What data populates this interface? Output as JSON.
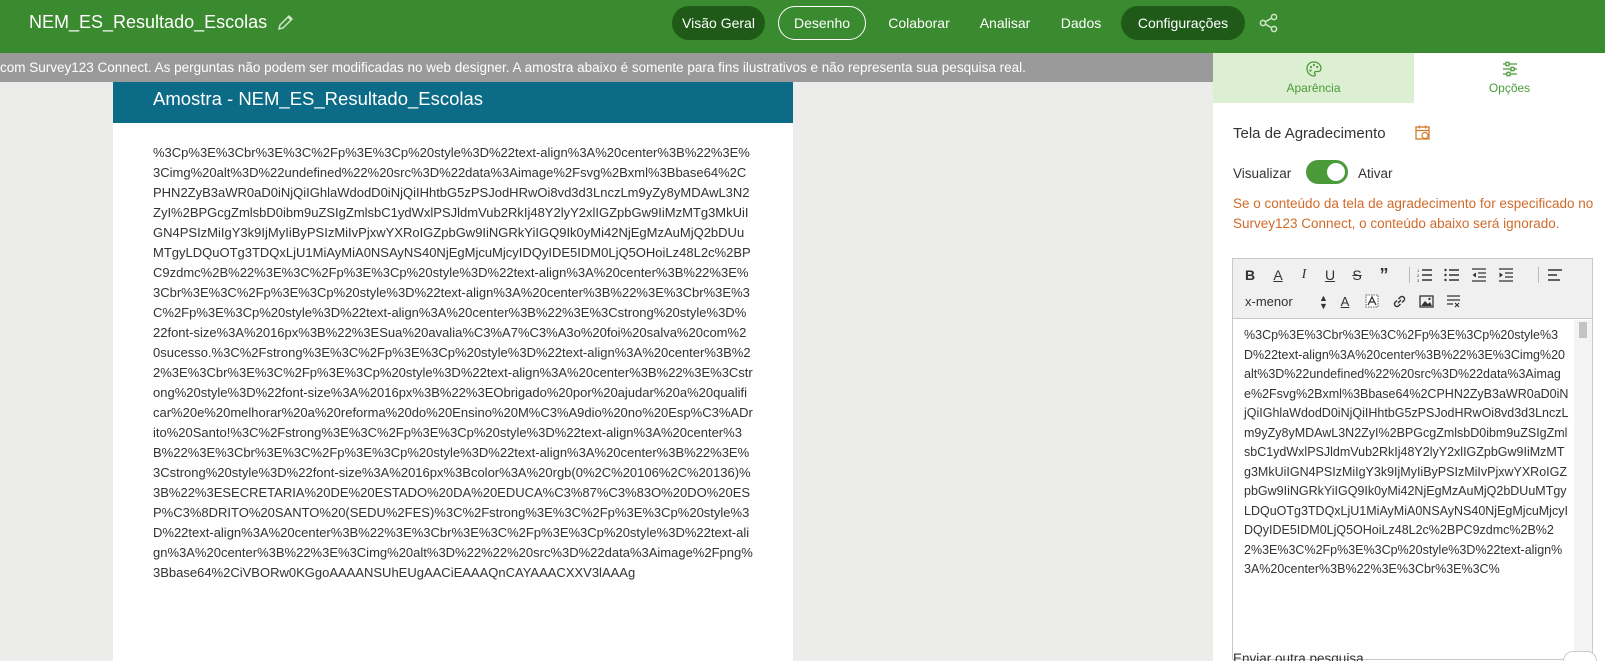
{
  "app": {
    "title": "NEM_ES_Resultado_Escolas",
    "brand_color": "#3a8a2f",
    "nav": [
      {
        "label": "Visão Geral",
        "state": "active"
      },
      {
        "label": "Desenho",
        "state": "outlined"
      },
      {
        "label": "Colaborar",
        "state": "normal"
      },
      {
        "label": "Analisar",
        "state": "normal"
      },
      {
        "label": "Dados",
        "state": "normal"
      },
      {
        "label": "Configurações",
        "state": "active"
      }
    ],
    "icons": {
      "edit": "pencil-icon",
      "share": "share-icon"
    }
  },
  "notice": {
    "text": "com Survey123 Connect. As perguntas não podem ser modificadas no web designer. A amostra abaixo é somente para fins ilustrativos e não representa sua pesquisa real."
  },
  "preview": {
    "header": "Amostra - NEM_ES_Resultado_Escolas",
    "header_color": "#0c6b86",
    "body": "%3Cp%3E%3Cbr%3E%3C%2Fp%3E%3Cp%20style%3D%22text-align%3A%20center%3B%22%3E%3Cimg%20alt%3D%22undefined%22%20src%3D%22data%3Aimage%2Fsvg%2Bxml%3Bbase64%2CPHN2ZyB3aWR0aD0iNjQiIGhlaWdodD0iNjQiIHhtbG5zPSJodHRwOi8vd3d3LnczLm9yZy8yMDAwL3N2ZyI%2BPGcgZmlsbD0ibm9uZSIgZmlsbC1ydWxlPSJldmVub2RkIj48Y2lyY2xlIGZpbGw9IiMzMTg3MkUiIGN4PSIzMiIgY3k9IjMyIiByPSIzMiIvPjxwYXRoIGZpbGw9IiNGRkYiIGQ9Ik0yMi42NjEgMzAuMjQ2bDUuMTgyLDQuOTg3TDQxLjU1MiAyMiA0NSAyNS40NjEgMjcuMjcyIDQyIDE5IDM0LjQ5OHoiLz48L2c%2BPC9zdmc%2B%22%3E%3C%2Fp%3E%3Cp%20style%3D%22text-align%3A%20center%3B%22%3E%3Cbr%3E%3C%2Fp%3E%3Cp%20style%3D%22text-align%3A%20center%3B%22%3E%3Cbr%3E%3C%2Fp%3E%3Cp%20style%3D%22text-align%3A%20center%3B%22%3E%3Cstrong%20style%3D%22font-size%3A%2016px%3B%22%3ESua%20avalia%C3%A7%C3%A3o%20foi%20salva%20com%20sucesso.%3C%2Fstrong%3E%3C%2Fp%3E%3Cp%20style%3D%22text-align%3A%20center%3B%22%3E%3Cbr%3E%3C%2Fp%3E%3Cp%20style%3D%22text-align%3A%20center%3B%22%3E%3Cstrong%20style%3D%22font-size%3A%2016px%3B%22%3EObrigado%20por%20ajudar%20a%20qualificar%20e%20melhorar%20a%20reforma%20do%20Ensino%20M%C3%A9dio%20no%20Esp%C3%ADrito%20Santo!%3C%2Fstrong%3E%3C%2Fp%3E%3Cp%20style%3D%22text-align%3A%20center%3B%22%3E%3Cbr%3E%3C%2Fp%3E%3Cp%20style%3D%22text-align%3A%20center%3B%22%3E%3Cstrong%20style%3D%22font-size%3A%2016px%3Bcolor%3A%20rgb(0%2C%20106%2C%20136)%3B%22%3ESECRETARIA%20DE%20ESTADO%20DA%20EDUCA%C3%87%C3%83O%20DO%20ESP%C3%8DRITO%20SANTO%20(SEDU%2FES)%3C%2Fstrong%3E%3C%2Fp%3E%3Cp%20style%3D%22text-align%3A%20center%3B%22%3E%3Cbr%3E%3C%2Fp%3E%3Cp%20style%3D%22text-align%3A%20center%3B%22%3E%3Cimg%20alt%3D%22%22%20src%3D%22data%3Aimage%2Fpng%3Bbase64%2CiVBORw0KGgoAAAANSUhEUgAACiEAAAQnCAYAAACXXV3lAAAg"
  },
  "panel": {
    "tabs": [
      {
        "label": "Aparência",
        "icon": "palette-icon",
        "active": true
      },
      {
        "label": "Opções",
        "icon": "sliders-icon",
        "active": false
      }
    ],
    "section_title": "Tela de Agradecimento",
    "visualizar_label": "Visualizar",
    "toggle_on": true,
    "ativar_label": "Ativar",
    "warning": "Se o conteúdo da tela de agradecimento for especificado no Survey123 Connect, o conteúdo abaixo será ignorado.",
    "warning_color": "#d06a2a",
    "font_size": "x-menor",
    "editor_text": "%3Cp%3E%3Cbr%3E%3C%2Fp%3E%3Cp%20style%3D%22text-align%3A%20center%3B%22%3E%3Cimg%20alt%3D%22undefined%22%20src%3D%22data%3Aimage%2Fsvg%2Bxml%3Bbase64%2CPHN2ZyB3aWR0aD0iNjQiIGhlaWdodD0iNjQiIHhtbG5zPSJodHRwOi8vd3d3LnczLm9yZy8yMDAwL3N2ZyI%2BPGcgZmlsbD0ibm9uZSIgZmlsbC1ydWxlPSJldmVub2RkIj48Y2lyY2xlIGZpbGw9IiMzMTg3MkUiIGN4PSIzMiIgY3k9IjMyIiByPSIzMiIvPjxwYXRoIGZpbGw9IiNGRkYiIGQ9Ik0yMi42NjEgMzAuMjQ2bDUuMTgyLDQuOTg3TDQxLjU1MiAyMiA0NSAyNS40NjEgMjcuMjcyIDQyIDE5IDM0LjQ5OHoiLz48L2c%2BPC9zdmc%2B%22%3E%3C%2Fp%3E%3Cp%20style%3D%22text-align%3A%20center%3B%22%3E%3Cbr%3E%3C%",
    "enviar_label": "Enviar outra pesquisa"
  }
}
